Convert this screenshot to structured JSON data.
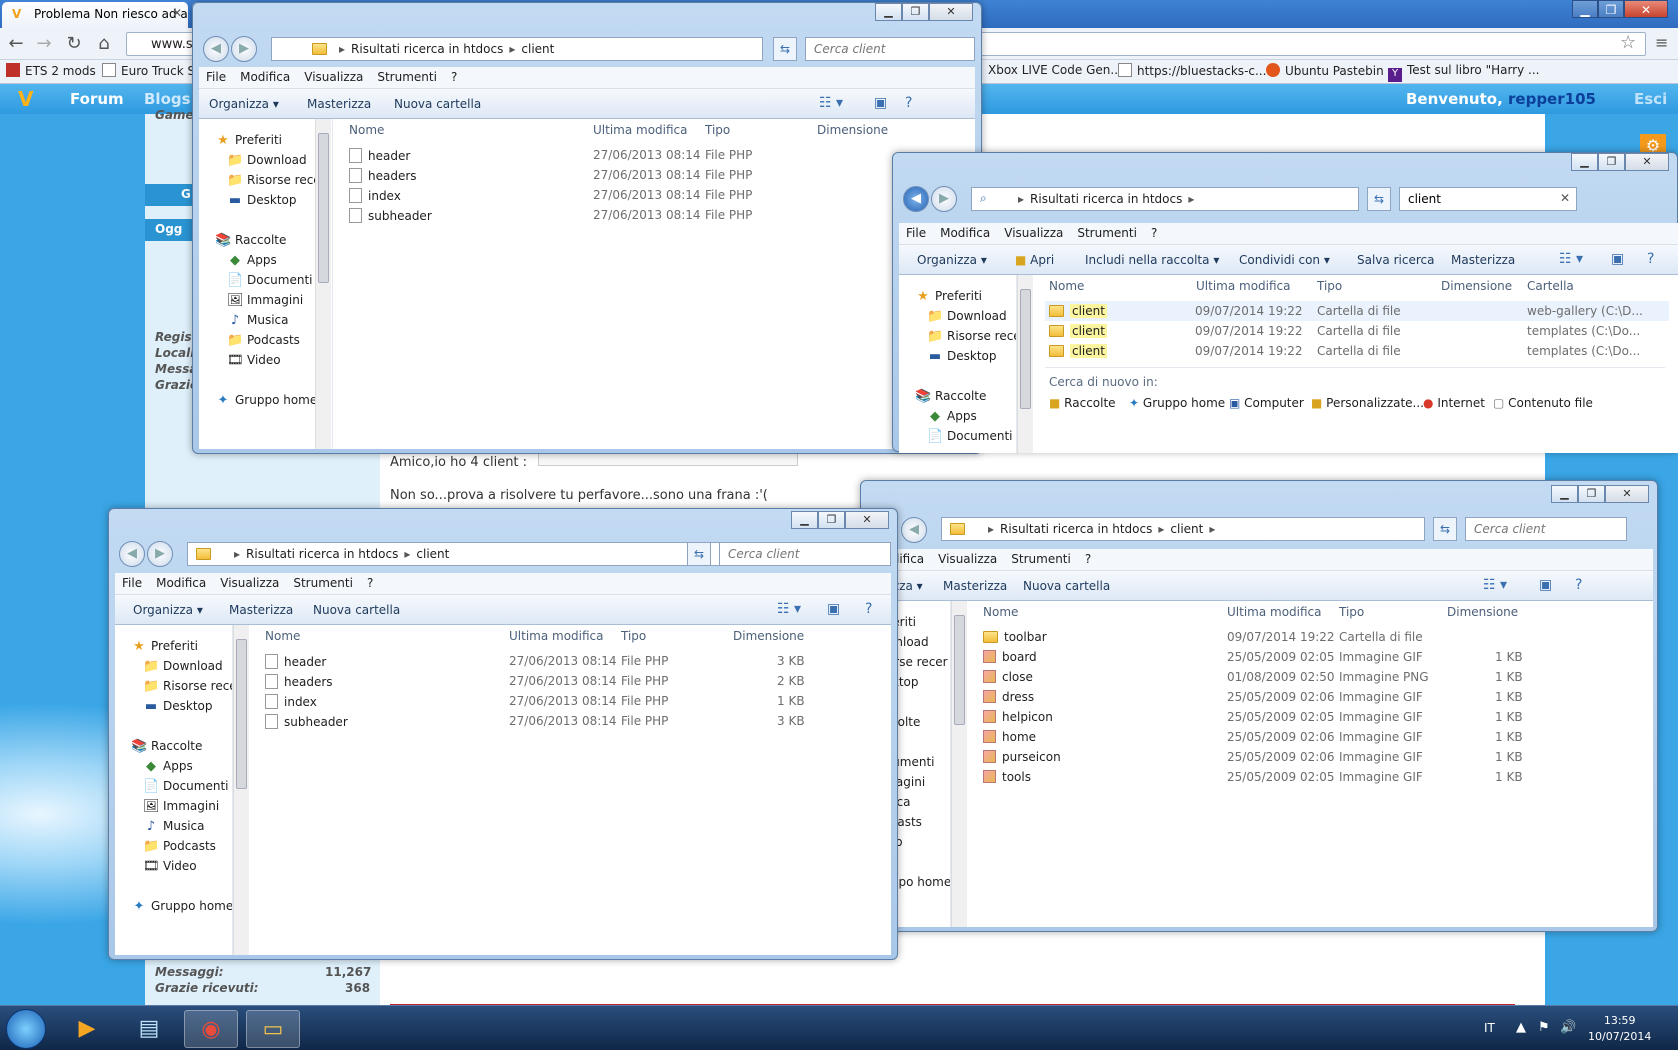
{
  "browser": {
    "tabs": [
      {
        "title": "Problema Non riesco ad a",
        "active": true
      },
      {
        "title": "",
        "active": false
      },
      {
        "title": "",
        "active": false
      }
    ],
    "url": "www.s",
    "bookmarks": [
      {
        "label": "ETS 2 mods"
      },
      {
        "label": "Euro Truck Si"
      },
      {
        "label": "Xbox LIVE Code Gen..."
      },
      {
        "label": "https://bluestacks-c..."
      },
      {
        "label": "Ubuntu Pastebin"
      },
      {
        "label": "Test sul libro \"Harry ..."
      }
    ]
  },
  "site": {
    "nav": [
      "Forum",
      "Blogs"
    ],
    "welcome": "Benvenuto,",
    "username": "repper105",
    "logout": "Esci",
    "side_fragments": [
      "Game",
      "G",
      "Ogg",
      "Regis",
      "Locali",
      "Messa",
      "Grazie"
    ],
    "post_line1": "Amico,io ho 4 client :",
    "post_line2": "Non so...prova a risolvere tu perfavore...sono una frana :'(",
    "stats": [
      {
        "label": "Messaggi:",
        "value": "11,267"
      },
      {
        "label": "Grazie ricevuti:",
        "value": "368"
      }
    ]
  },
  "explorer_common": {
    "menu": [
      "File",
      "Modifica",
      "Visualizza",
      "Strumenti",
      "?"
    ],
    "breadcrumb": [
      "Risultati ricerca in htdocs",
      "client"
    ],
    "search_placeholder": "Cerca client",
    "organize": "Organizza",
    "burn": "Masterizza",
    "new_folder": "Nuova cartella",
    "nav_favorites": "Preferiti",
    "nav_download": "Download",
    "nav_recent": "Risorse recer",
    "nav_desktop": "Desktop",
    "nav_libraries": "Raccolte",
    "nav_apps": "Apps",
    "nav_documents": "Documenti",
    "nav_pictures": "Immagini",
    "nav_music": "Musica",
    "nav_podcasts": "Podcasts",
    "nav_video": "Video",
    "nav_homegroup": "Gruppo home",
    "col_name": "Nome",
    "col_modified": "Ultima modifica",
    "col_type": "Tipo",
    "col_size": "Dimensione",
    "col_folder": "Cartella"
  },
  "window_top_left": {
    "files": [
      {
        "name": "header",
        "modified": "27/06/2013 08:14",
        "type": "File PHP"
      },
      {
        "name": "headers",
        "modified": "27/06/2013 08:14",
        "type": "File PHP"
      },
      {
        "name": "index",
        "modified": "27/06/2013 08:14",
        "type": "File PHP"
      },
      {
        "name": "subheader",
        "modified": "27/06/2013 08:14",
        "type": "File PHP"
      }
    ]
  },
  "window_search": {
    "search_value": "client",
    "toolbar": [
      "Apri",
      "Includi nella raccolta",
      "Condividi con",
      "Salva ricerca",
      "Masterizza"
    ],
    "results": [
      {
        "name": "client",
        "modified": "09/07/2014 19:22",
        "type": "Cartella di file",
        "folder": "web-gallery (C:\\D..."
      },
      {
        "name": "client",
        "modified": "09/07/2014 19:22",
        "type": "Cartella di file",
        "folder": "templates (C:\\Do..."
      },
      {
        "name": "client",
        "modified": "09/07/2014 19:22",
        "type": "Cartella di file",
        "folder": "templates (C:\\Do..."
      }
    ],
    "search_again": "Cerca di nuovo in:",
    "search_again_targets": [
      "Raccolte",
      "Gruppo home",
      "Computer",
      "Personalizzate...",
      "Internet",
      "Contenuto file"
    ]
  },
  "window_bottom_left": {
    "files": [
      {
        "name": "header",
        "modified": "27/06/2013 08:14",
        "type": "File PHP",
        "size": "3 KB"
      },
      {
        "name": "headers",
        "modified": "27/06/2013 08:14",
        "type": "File PHP",
        "size": "2 KB"
      },
      {
        "name": "index",
        "modified": "27/06/2013 08:14",
        "type": "File PHP",
        "size": "1 KB"
      },
      {
        "name": "subheader",
        "modified": "27/06/2013 08:14",
        "type": "File PHP",
        "size": "3 KB"
      }
    ]
  },
  "window_bottom_right": {
    "files": [
      {
        "name": "toolbar",
        "modified": "09/07/2014 19:22",
        "type": "Cartella di file",
        "size": ""
      },
      {
        "name": "board",
        "modified": "25/05/2009 02:05",
        "type": "Immagine GIF",
        "size": "1 KB"
      },
      {
        "name": "close",
        "modified": "01/08/2009 02:50",
        "type": "Immagine PNG",
        "size": "1 KB"
      },
      {
        "name": "dress",
        "modified": "25/05/2009 02:06",
        "type": "Immagine GIF",
        "size": "1 KB"
      },
      {
        "name": "helpicon",
        "modified": "25/05/2009 02:05",
        "type": "Immagine GIF",
        "size": "1 KB"
      },
      {
        "name": "home",
        "modified": "25/05/2009 02:06",
        "type": "Immagine GIF",
        "size": "1 KB"
      },
      {
        "name": "purseicon",
        "modified": "25/05/2009 02:06",
        "type": "Immagine GIF",
        "size": "1 KB"
      },
      {
        "name": "tools",
        "modified": "25/05/2009 02:05",
        "type": "Immagine GIF",
        "size": "1 KB"
      }
    ]
  },
  "taskbar": {
    "language": "IT",
    "time": "13:59",
    "date": "10/07/2014"
  }
}
